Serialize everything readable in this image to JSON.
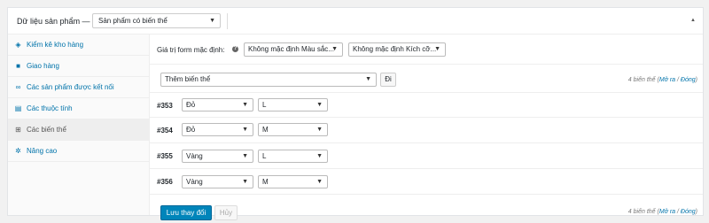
{
  "header": {
    "title": "Dữ liệu sản phẩm —",
    "product_type": "Sản phẩm có biến thể"
  },
  "tabs": [
    {
      "label": "Kiểm kê kho hàng",
      "icon": "tag-icon"
    },
    {
      "label": "Giao hàng",
      "icon": "truck-icon"
    },
    {
      "label": "Các sản phẩm được kết nối",
      "icon": "link-icon"
    },
    {
      "label": "Các thuộc tính",
      "icon": "table-icon"
    },
    {
      "label": "Các biến thể",
      "icon": "grid-icon",
      "active": true
    },
    {
      "label": "Nâng cao",
      "icon": "gear-icon"
    }
  ],
  "defaults": {
    "label": "Giá trị form mặc định:",
    "color": "Không mặc định Màu sắc...",
    "size": "Không mặc định Kích cỡ..."
  },
  "toolbar": {
    "action": "Thêm biến thể",
    "go_label": "Đi",
    "count_text": "4 biến thể",
    "expand_text": "Mở ra",
    "separator": "/",
    "collapse_text": "Đóng"
  },
  "variations": [
    {
      "id": "#353",
      "color": "Đỏ",
      "size": "L"
    },
    {
      "id": "#354",
      "color": "Đỏ",
      "size": "M"
    },
    {
      "id": "#355",
      "color": "Vàng",
      "size": "L"
    },
    {
      "id": "#356",
      "color": "Vàng",
      "size": "M"
    }
  ],
  "footer": {
    "save_label": "Lưu thay đổi",
    "cancel_label": "Hủy"
  },
  "colors": {
    "link": "#0073aa",
    "primary": "#0085ba",
    "active_tab_bg": "#eeeeee"
  }
}
